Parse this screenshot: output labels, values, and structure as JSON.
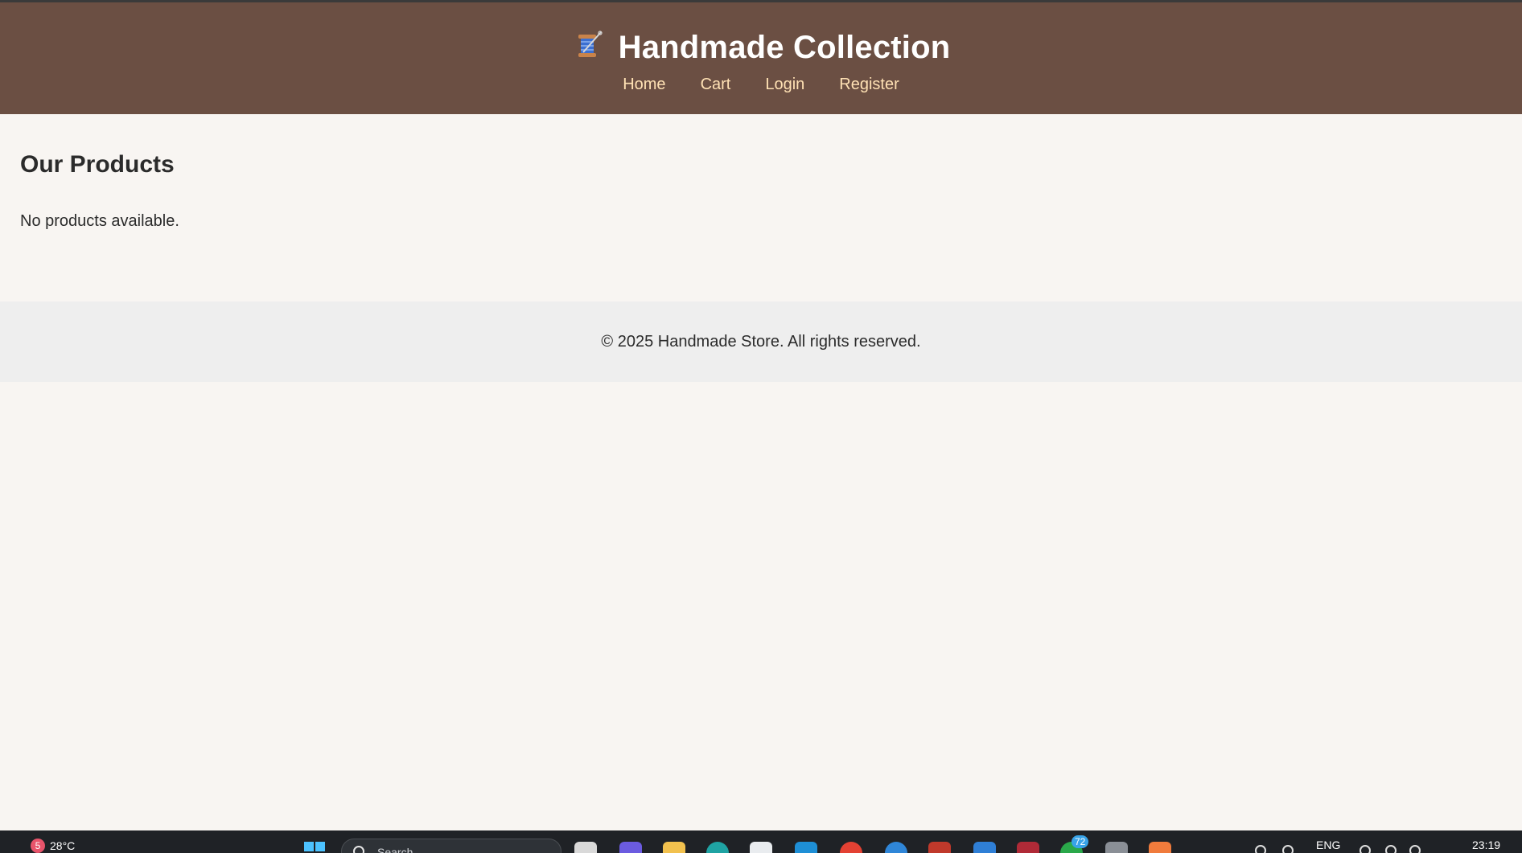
{
  "header": {
    "logo_icon": "sewing-spool-icon",
    "title": "Handmade Collection",
    "nav": [
      {
        "label": "Home"
      },
      {
        "label": "Cart"
      },
      {
        "label": "Login"
      },
      {
        "label": "Register"
      }
    ]
  },
  "main": {
    "heading": "Our Products",
    "empty_message": "No products available."
  },
  "footer": {
    "text": "© 2025 Handmade Store. All rights reserved."
  },
  "taskbar": {
    "weather_badge": "5",
    "temperature": "28°C",
    "search_placeholder": "Search",
    "notification_count": "72",
    "language": "ENG",
    "time": "23:19"
  },
  "colors": {
    "header_bg": "#6b4f43",
    "nav_link": "#ffe1b4",
    "page_bg": "#f8f5f2",
    "footer_bg": "#eeeeee"
  }
}
